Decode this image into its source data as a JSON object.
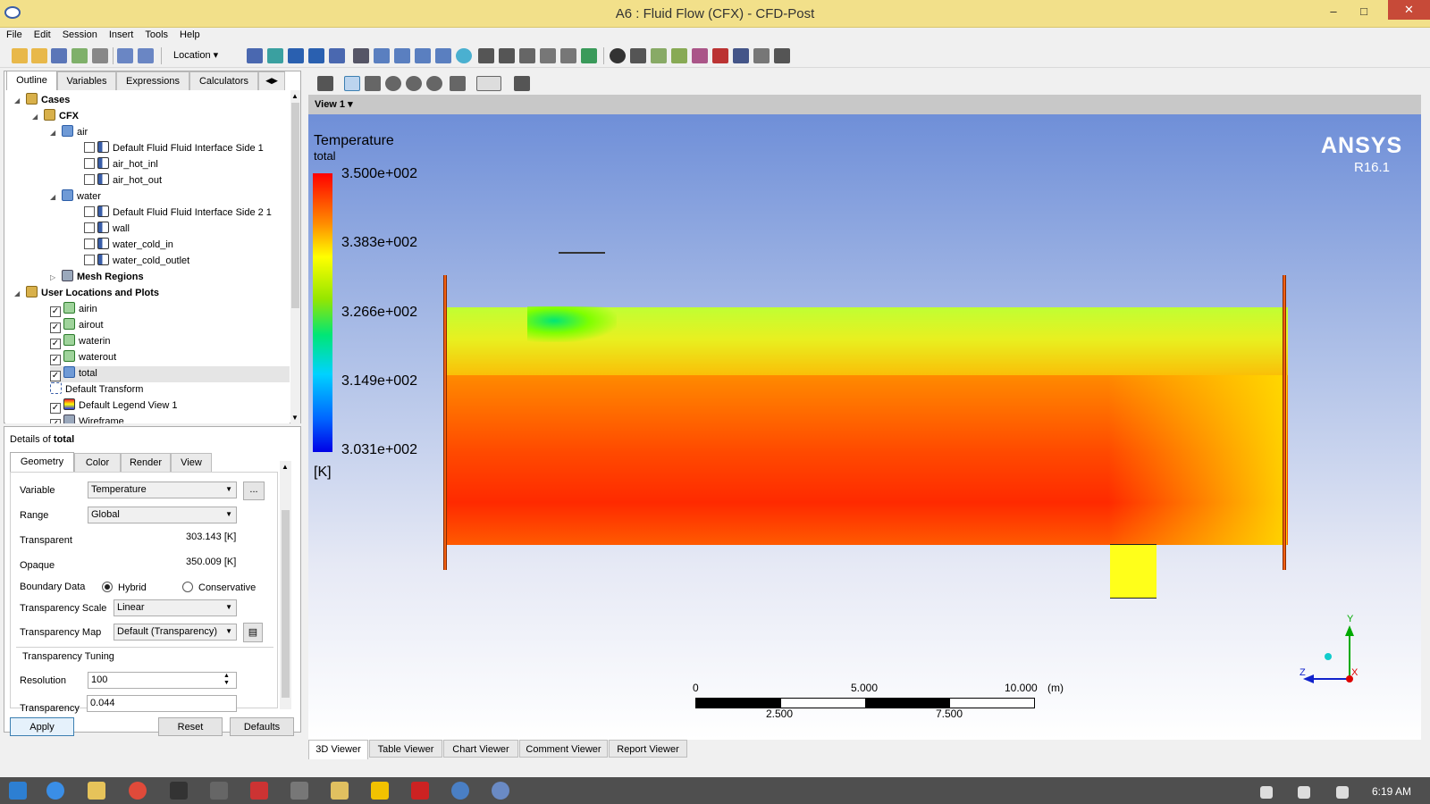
{
  "window": {
    "title": "A6 : Fluid Flow (CFX) - CFD-Post",
    "minimize": "–",
    "maximize": "□",
    "close": "✕"
  },
  "menu": [
    "File",
    "Edit",
    "Session",
    "Insert",
    "Tools",
    "Help"
  ],
  "toolbar": {
    "location_label": "Location"
  },
  "left_tabs": [
    "Outline",
    "Variables",
    "Expressions",
    "Calculators"
  ],
  "tree": {
    "cases": "Cases",
    "cfx": "CFX",
    "air": "air",
    "air_items": [
      "Default Fluid Fluid Interface Side 1",
      "air_hot_inl",
      "air_hot_out"
    ],
    "water": "water",
    "water_items": [
      "Default Fluid Fluid Interface Side 2 1",
      "wall",
      "water_cold_in",
      "water_cold_outlet"
    ],
    "mesh_regions": "Mesh Regions",
    "user_locations": "User Locations and Plots",
    "user_items": [
      "airin",
      "airout",
      "waterin",
      "waterout",
      "total"
    ],
    "default_transform": "Default Transform",
    "default_legend": "Default Legend View 1",
    "wireframe": "Wireframe"
  },
  "details": {
    "title_prefix": "Details of ",
    "title_obj": "total",
    "tabs": [
      "Geometry",
      "Color",
      "Render",
      "View"
    ],
    "variable_label": "Variable",
    "variable_value": "Temperature",
    "more": "...",
    "range_label": "Range",
    "range_value": "Global",
    "transparent_label": "Transparent",
    "transparent_value": "303.143 [K]",
    "opaque_label": "Opaque",
    "opaque_value": "350.009 [K]",
    "boundary_label": "Boundary Data",
    "hybrid": "Hybrid",
    "conservative": "Conservative",
    "tscale_label": "Transparency Scale",
    "tscale_value": "Linear",
    "tmap_label": "Transparency Map",
    "tmap_value": "Default (Transparency)",
    "tuning_label": "Transparency Tuning",
    "resolution_label": "Resolution",
    "resolution_value": "100",
    "transparency_label": "Transparency",
    "transparency_value": "0.044",
    "apply": "Apply",
    "reset": "Reset",
    "defaults": "Defaults"
  },
  "viewer": {
    "view_label": "View 1",
    "legend_title": "Temperature",
    "legend_sub": "total",
    "legend_ticks": [
      "3.500e+002",
      "3.383e+002",
      "3.266e+002",
      "3.149e+002",
      "3.031e+002"
    ],
    "legend_unit": "[K]",
    "brand": "ANSYS",
    "version": "R16.1",
    "scale_top": [
      "0",
      "5.000",
      "10.000",
      "(m)"
    ],
    "scale_bottom": [
      "2.500",
      "7.500"
    ],
    "axes": {
      "y": "Y",
      "z": "Z",
      "x": "X"
    }
  },
  "bottom_tabs": [
    "3D Viewer",
    "Table Viewer",
    "Chart Viewer",
    "Comment Viewer",
    "Report Viewer"
  ],
  "taskbar": {
    "time": "6:19 AM"
  }
}
